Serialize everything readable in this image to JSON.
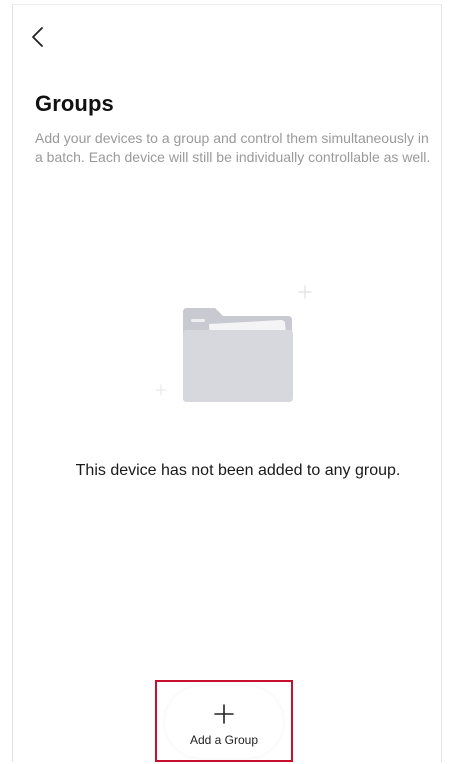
{
  "header": {
    "back_icon": "chevron-left-icon",
    "title": "Groups",
    "description": "Add your devices to a group and control them simultaneously in a batch. Each device will still be individually controllable as well."
  },
  "empty_state": {
    "illustration_icon": "empty-folder-icon",
    "message": "This device has not been added to any group."
  },
  "footer": {
    "add_group_icon": "plus-icon",
    "add_group_label": "Add a Group"
  },
  "colors": {
    "highlight_border": "#c8102e",
    "folder": "#d5d6dc",
    "text_secondary": "#9a9a9a"
  }
}
